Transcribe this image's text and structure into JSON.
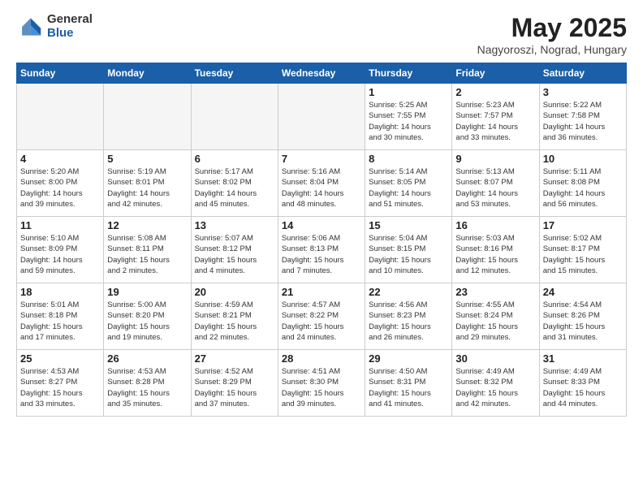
{
  "logo": {
    "general": "General",
    "blue": "Blue"
  },
  "title": "May 2025",
  "location": "Nagyoroszi, Nograd, Hungary",
  "weekdays": [
    "Sunday",
    "Monday",
    "Tuesday",
    "Wednesday",
    "Thursday",
    "Friday",
    "Saturday"
  ],
  "weeks": [
    [
      {
        "day": "",
        "info": ""
      },
      {
        "day": "",
        "info": ""
      },
      {
        "day": "",
        "info": ""
      },
      {
        "day": "",
        "info": ""
      },
      {
        "day": "1",
        "info": "Sunrise: 5:25 AM\nSunset: 7:55 PM\nDaylight: 14 hours\nand 30 minutes."
      },
      {
        "day": "2",
        "info": "Sunrise: 5:23 AM\nSunset: 7:57 PM\nDaylight: 14 hours\nand 33 minutes."
      },
      {
        "day": "3",
        "info": "Sunrise: 5:22 AM\nSunset: 7:58 PM\nDaylight: 14 hours\nand 36 minutes."
      }
    ],
    [
      {
        "day": "4",
        "info": "Sunrise: 5:20 AM\nSunset: 8:00 PM\nDaylight: 14 hours\nand 39 minutes."
      },
      {
        "day": "5",
        "info": "Sunrise: 5:19 AM\nSunset: 8:01 PM\nDaylight: 14 hours\nand 42 minutes."
      },
      {
        "day": "6",
        "info": "Sunrise: 5:17 AM\nSunset: 8:02 PM\nDaylight: 14 hours\nand 45 minutes."
      },
      {
        "day": "7",
        "info": "Sunrise: 5:16 AM\nSunset: 8:04 PM\nDaylight: 14 hours\nand 48 minutes."
      },
      {
        "day": "8",
        "info": "Sunrise: 5:14 AM\nSunset: 8:05 PM\nDaylight: 14 hours\nand 51 minutes."
      },
      {
        "day": "9",
        "info": "Sunrise: 5:13 AM\nSunset: 8:07 PM\nDaylight: 14 hours\nand 53 minutes."
      },
      {
        "day": "10",
        "info": "Sunrise: 5:11 AM\nSunset: 8:08 PM\nDaylight: 14 hours\nand 56 minutes."
      }
    ],
    [
      {
        "day": "11",
        "info": "Sunrise: 5:10 AM\nSunset: 8:09 PM\nDaylight: 14 hours\nand 59 minutes."
      },
      {
        "day": "12",
        "info": "Sunrise: 5:08 AM\nSunset: 8:11 PM\nDaylight: 15 hours\nand 2 minutes."
      },
      {
        "day": "13",
        "info": "Sunrise: 5:07 AM\nSunset: 8:12 PM\nDaylight: 15 hours\nand 4 minutes."
      },
      {
        "day": "14",
        "info": "Sunrise: 5:06 AM\nSunset: 8:13 PM\nDaylight: 15 hours\nand 7 minutes."
      },
      {
        "day": "15",
        "info": "Sunrise: 5:04 AM\nSunset: 8:15 PM\nDaylight: 15 hours\nand 10 minutes."
      },
      {
        "day": "16",
        "info": "Sunrise: 5:03 AM\nSunset: 8:16 PM\nDaylight: 15 hours\nand 12 minutes."
      },
      {
        "day": "17",
        "info": "Sunrise: 5:02 AM\nSunset: 8:17 PM\nDaylight: 15 hours\nand 15 minutes."
      }
    ],
    [
      {
        "day": "18",
        "info": "Sunrise: 5:01 AM\nSunset: 8:18 PM\nDaylight: 15 hours\nand 17 minutes."
      },
      {
        "day": "19",
        "info": "Sunrise: 5:00 AM\nSunset: 8:20 PM\nDaylight: 15 hours\nand 19 minutes."
      },
      {
        "day": "20",
        "info": "Sunrise: 4:59 AM\nSunset: 8:21 PM\nDaylight: 15 hours\nand 22 minutes."
      },
      {
        "day": "21",
        "info": "Sunrise: 4:57 AM\nSunset: 8:22 PM\nDaylight: 15 hours\nand 24 minutes."
      },
      {
        "day": "22",
        "info": "Sunrise: 4:56 AM\nSunset: 8:23 PM\nDaylight: 15 hours\nand 26 minutes."
      },
      {
        "day": "23",
        "info": "Sunrise: 4:55 AM\nSunset: 8:24 PM\nDaylight: 15 hours\nand 29 minutes."
      },
      {
        "day": "24",
        "info": "Sunrise: 4:54 AM\nSunset: 8:26 PM\nDaylight: 15 hours\nand 31 minutes."
      }
    ],
    [
      {
        "day": "25",
        "info": "Sunrise: 4:53 AM\nSunset: 8:27 PM\nDaylight: 15 hours\nand 33 minutes."
      },
      {
        "day": "26",
        "info": "Sunrise: 4:53 AM\nSunset: 8:28 PM\nDaylight: 15 hours\nand 35 minutes."
      },
      {
        "day": "27",
        "info": "Sunrise: 4:52 AM\nSunset: 8:29 PM\nDaylight: 15 hours\nand 37 minutes."
      },
      {
        "day": "28",
        "info": "Sunrise: 4:51 AM\nSunset: 8:30 PM\nDaylight: 15 hours\nand 39 minutes."
      },
      {
        "day": "29",
        "info": "Sunrise: 4:50 AM\nSunset: 8:31 PM\nDaylight: 15 hours\nand 41 minutes."
      },
      {
        "day": "30",
        "info": "Sunrise: 4:49 AM\nSunset: 8:32 PM\nDaylight: 15 hours\nand 42 minutes."
      },
      {
        "day": "31",
        "info": "Sunrise: 4:49 AM\nSunset: 8:33 PM\nDaylight: 15 hours\nand 44 minutes."
      }
    ]
  ]
}
